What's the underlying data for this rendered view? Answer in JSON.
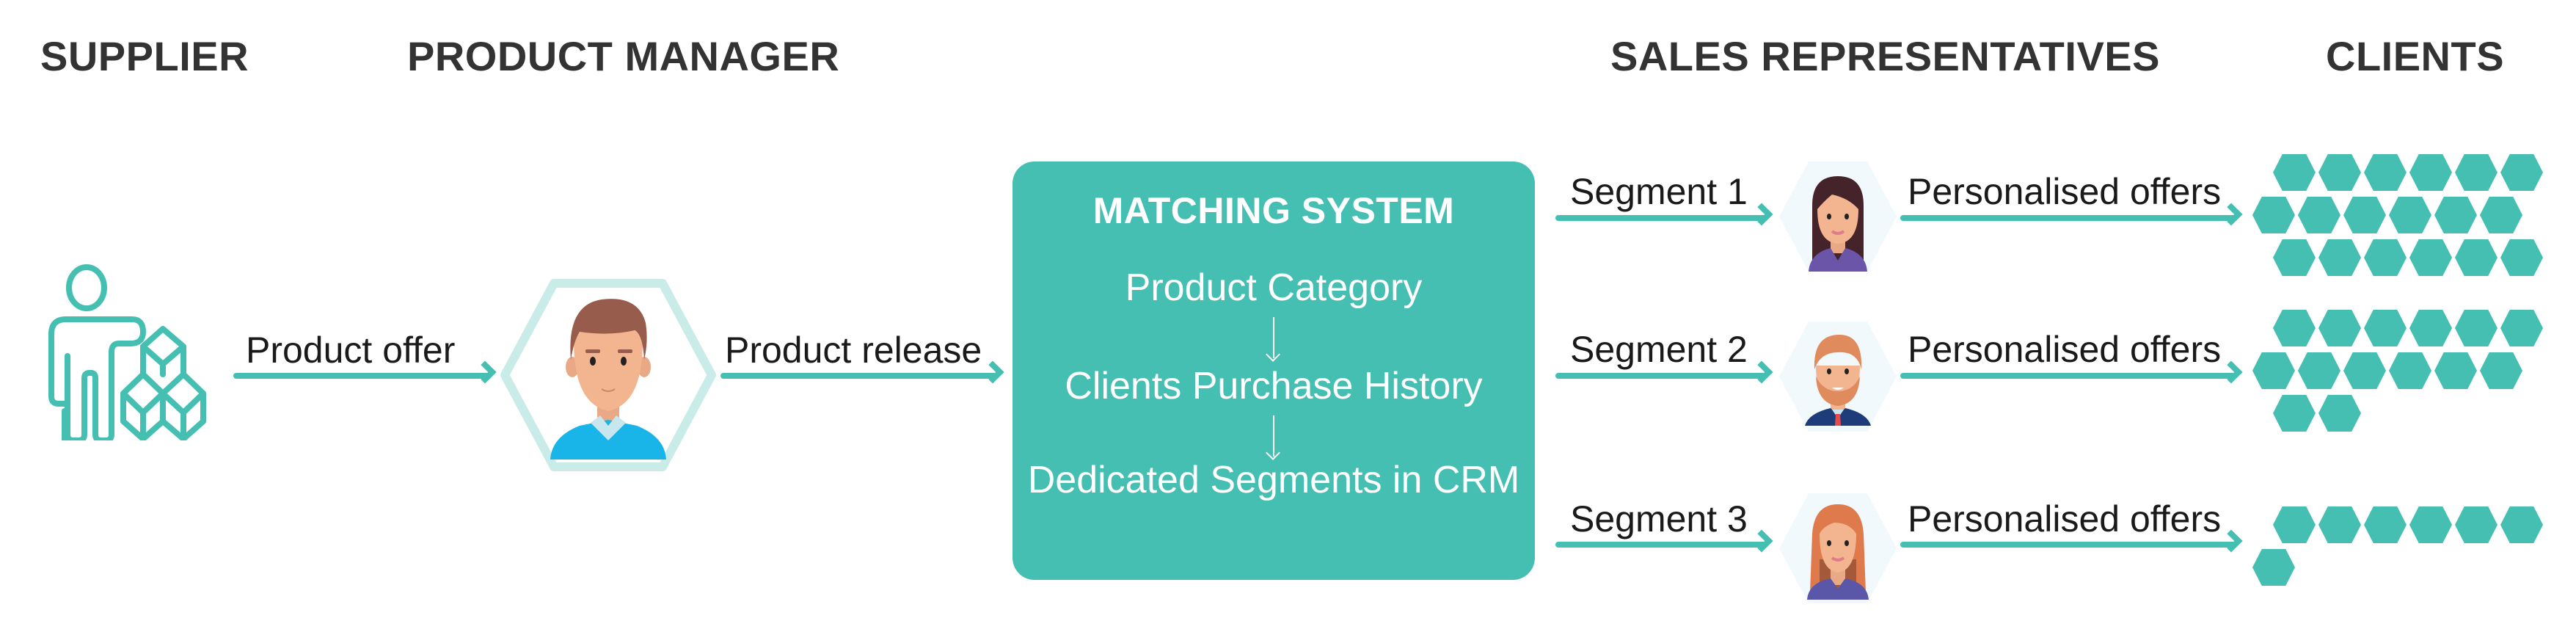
{
  "headings": {
    "supplier": "SUPPLIER",
    "product_manager": "PRODUCT MANAGER",
    "sales_representatives": "SALES REPRESENTATIVES",
    "clients": "CLIENTS"
  },
  "flows": {
    "product_offer": "Product offer",
    "product_release": "Product release"
  },
  "matching_system": {
    "title": "MATCHING SYSTEM",
    "steps": [
      "Product Category",
      "Clients Purchase History",
      "Dedicated Segments in CRM"
    ]
  },
  "segments": [
    {
      "label": "Segment 1",
      "offer_label": "Personalised offers",
      "rep": "female-dark-hair-rep",
      "client_count": 18,
      "rows": [
        6,
        6,
        6
      ]
    },
    {
      "label": "Segment 2",
      "offer_label": "Personalised offers",
      "rep": "male-bearded-rep",
      "client_count": 14,
      "rows": [
        6,
        6,
        2
      ]
    },
    {
      "label": "Segment 3",
      "offer_label": "Personalised offers",
      "rep": "female-red-hair-rep",
      "client_count": 7,
      "rows": [
        6,
        1
      ]
    }
  ],
  "icons": {
    "supplier": "person-with-boxes-icon",
    "product_manager": "male-avatar-icon",
    "client": "hexagon-icon"
  },
  "colors": {
    "accent": "#45bfb2",
    "heading": "#333333",
    "hex_outline": "#c9ece9",
    "rep_bg": "#f1f9fd"
  }
}
